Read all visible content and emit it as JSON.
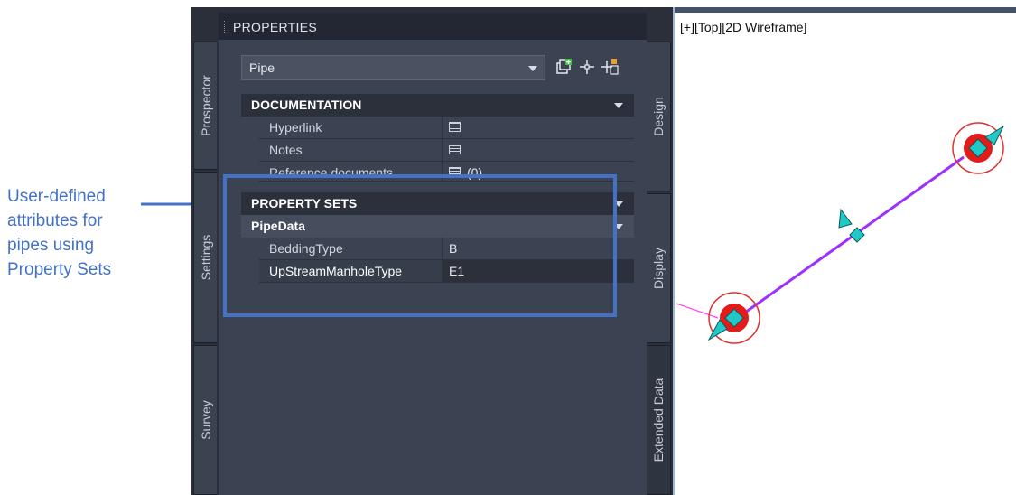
{
  "annotation": {
    "lines": [
      "User-defined",
      "attributes for",
      "pipes using",
      "Property Sets"
    ],
    "color": "#4472c4"
  },
  "palette": {
    "title": "PROPERTIES",
    "left_tabs": [
      "Prospector",
      "Settings",
      "Survey"
    ],
    "right_tabs": [
      "Design",
      "Display",
      "Extended Data"
    ],
    "object_selector": {
      "value": "Pipe"
    },
    "toolbar_icons": [
      "quick-select-icon",
      "select-objects-icon",
      "toggle-pickadd-icon"
    ],
    "sections": {
      "documentation": {
        "title": "DOCUMENTATION",
        "rows": [
          {
            "key": "Hyperlink",
            "value_icon": "table-icon"
          },
          {
            "key": "Notes",
            "value_icon": "table-icon"
          },
          {
            "key": "Reference documents",
            "value": "(0)",
            "value_icon": "table-icon"
          }
        ]
      },
      "property_sets": {
        "title": "PROPERTY SETS",
        "subsection": "PipeData",
        "rows": [
          {
            "key": "BeddingType",
            "value": "B"
          },
          {
            "key": "UpStreamManholeType",
            "value": "E1"
          }
        ]
      }
    }
  },
  "viewport": {
    "label": "[+][Top][2D Wireframe]",
    "colors": {
      "pipe": "#9b30ff",
      "structure_ring": "#e03030",
      "marker": "#20c8c8"
    }
  }
}
